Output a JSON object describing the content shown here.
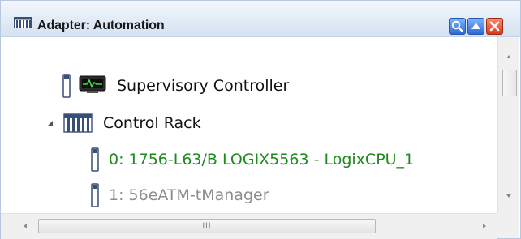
{
  "window": {
    "title": "Adapter: Automation",
    "title_icon": "rack-icon",
    "buttons": [
      {
        "name": "search",
        "icon": "magnifier-icon"
      },
      {
        "name": "collapse",
        "icon": "triangle-up-icon"
      },
      {
        "name": "close",
        "icon": "x-icon"
      }
    ]
  },
  "tree": {
    "items": [
      {
        "label": "Supervisory Controller",
        "icon": "controller-icon",
        "color": "#111111"
      },
      {
        "label": "Control Rack",
        "icon": "rack-icon",
        "expanded": true,
        "color": "#111111"
      },
      {
        "label": "0: 1756-L63/B LOGIX5563 - LogixCPU_1",
        "icon": "module-icon",
        "color": "#1e8a1e"
      },
      {
        "label": "1: 56eATM-tManager",
        "icon": "module-icon",
        "color": "#8c8c8c"
      }
    ]
  },
  "scrollbars": {
    "horizontal_grip": "III"
  },
  "colors": {
    "accent": "#2d69d6",
    "close": "#d83a1c",
    "titlebar": "#dfe8f4"
  }
}
